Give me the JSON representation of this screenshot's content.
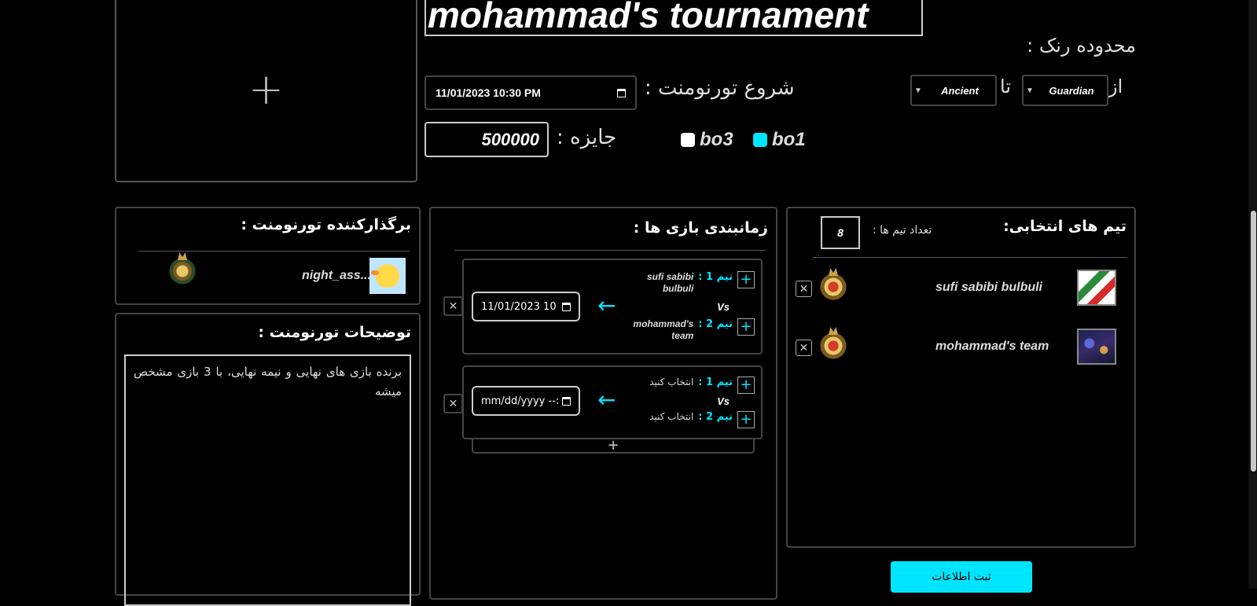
{
  "upload": {
    "icon": "+"
  },
  "tournament": {
    "title": "mohammad's tournament",
    "rank_range_label": "محدوده رنک :",
    "rank_from_label": "از",
    "rank_to_label": "تا",
    "rank_from": "Guardian",
    "rank_to": "Ancient",
    "start_label": "شروع تورنومنت :",
    "start_value": "11/01/2023 10:30 PM",
    "prize_label": "جایزه :",
    "prize_value": "500000",
    "formats": [
      {
        "label": "bo3",
        "selected": false,
        "color": "#ffffff"
      },
      {
        "label": "bo1",
        "selected": true,
        "color": "#00e5ff"
      }
    ]
  },
  "host": {
    "title": "برگذارکننده تورنومنت :",
    "name": "night_ass..."
  },
  "description": {
    "title": "توضیحات تورنومنت :",
    "text": "برنده بازی های نهایی و نیمه نهایی، با 3 بازی مشخص میشه"
  },
  "schedule": {
    "title": "زمانبندی بازی ها :",
    "vs": "Vs",
    "add_icon": "+",
    "matches": [
      {
        "team1_tag": "تیم 1 :",
        "team1_name": "sufi sabibi bulbuli",
        "team2_tag": "تیم 2 :",
        "team2_name": "mohammad's team",
        "date": "11/01/2023 10"
      },
      {
        "team1_tag": "تیم 1 :",
        "team1_name": "انتخاب کنید",
        "team2_tag": "تیم 2 :",
        "team2_name": "انتخاب کنید",
        "date": "mm/dd/yyyy --:"
      }
    ]
  },
  "teams": {
    "title": "تیم های انتخابی:",
    "count_label": "تعداد تیم ها :",
    "count_value": "8",
    "list": [
      {
        "name": "sufi sabibi bulbuli"
      },
      {
        "name": "mohammad's team"
      }
    ]
  },
  "submit_label": "ثبت اطلاعات",
  "accent_color": "#00e5ff"
}
